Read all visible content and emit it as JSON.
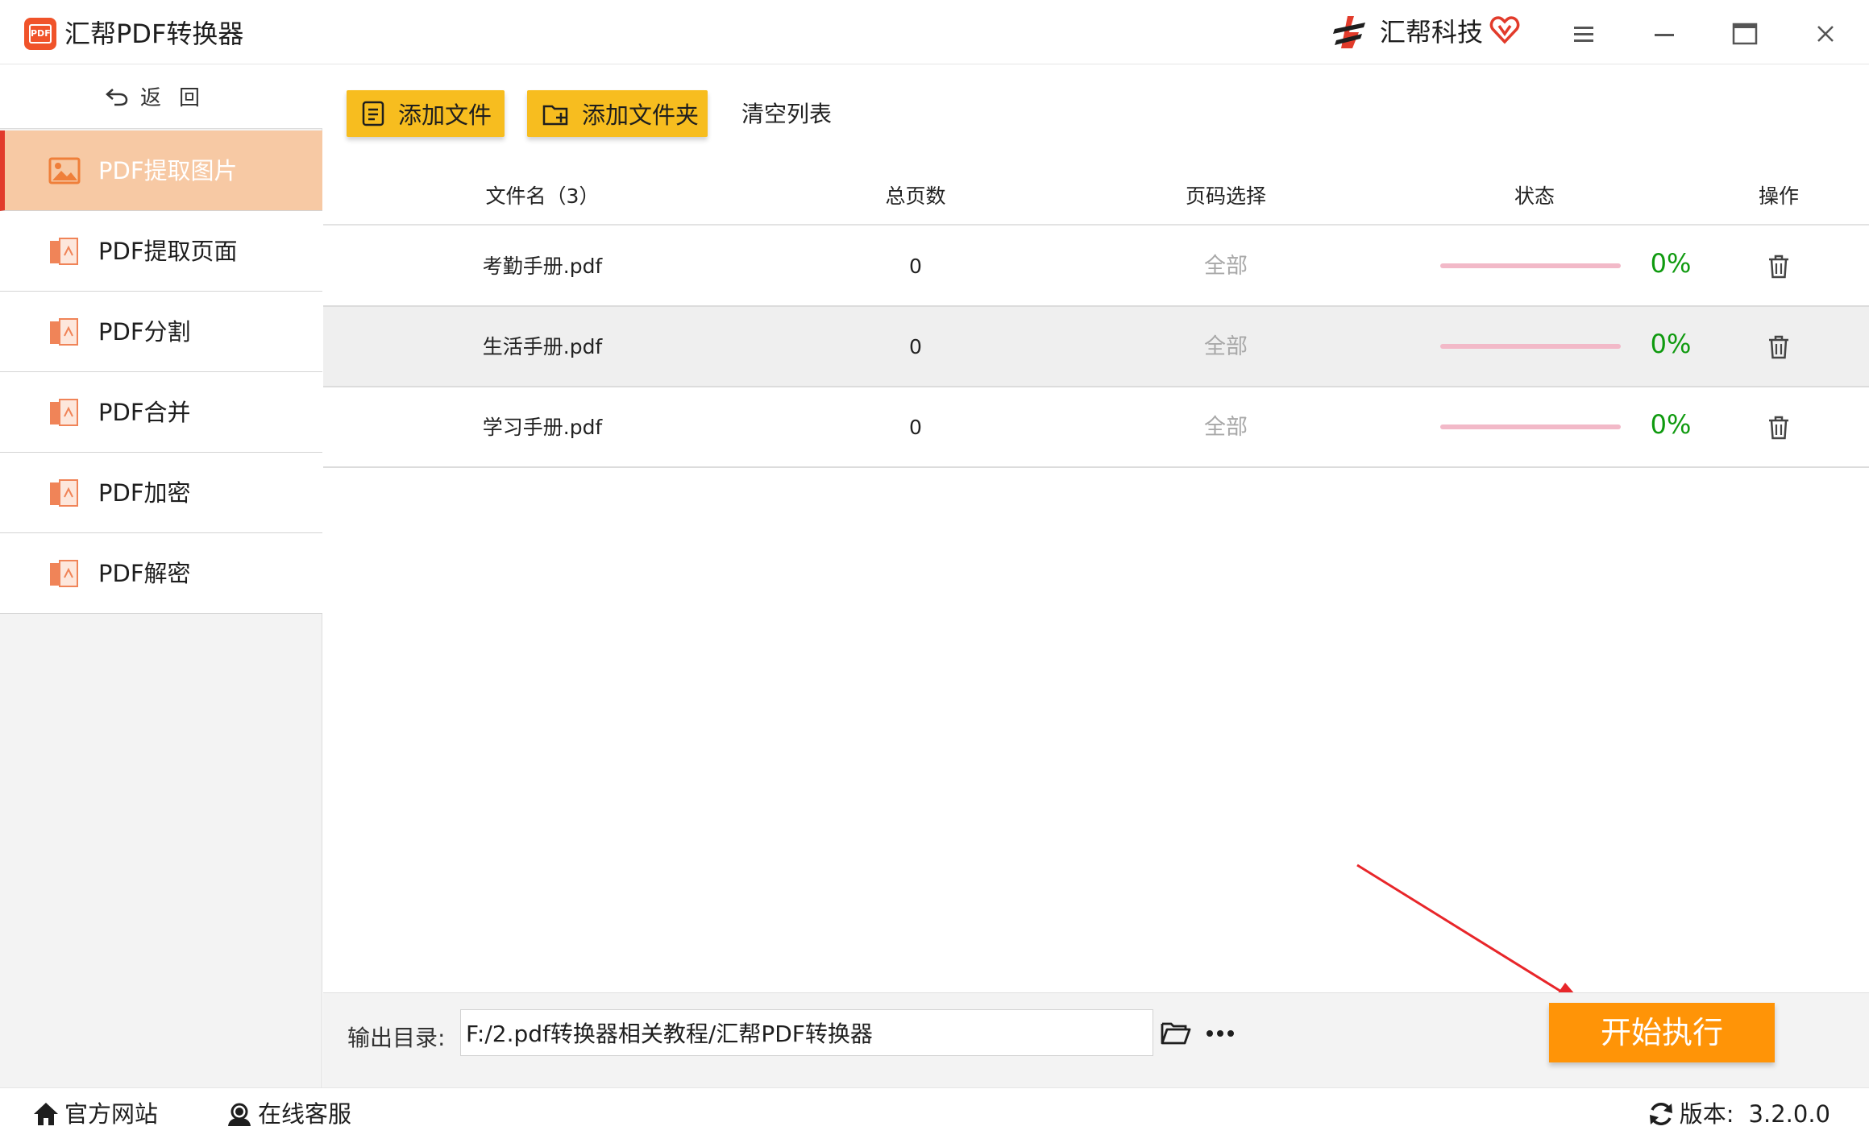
{
  "app": {
    "title": "汇帮PDF转换器",
    "logo_text": "PDF"
  },
  "brand": {
    "name": "汇帮科技",
    "accent": "#e23b2b"
  },
  "sidebar": {
    "back_label": "返回",
    "items": [
      {
        "label": "PDF提取图片",
        "icon": "image-icon",
        "active": true
      },
      {
        "label": "PDF提取页面",
        "icon": "pdf-file-icon",
        "active": false
      },
      {
        "label": "PDF分割",
        "icon": "pdf-file-icon",
        "active": false
      },
      {
        "label": "PDF合并",
        "icon": "pdf-file-icon",
        "active": false
      },
      {
        "label": "PDF加密",
        "icon": "pdf-file-icon",
        "active": false
      },
      {
        "label": "PDF解密",
        "icon": "pdf-file-icon",
        "active": false
      }
    ]
  },
  "toolbar": {
    "add_file_label": "添加文件",
    "add_folder_label": "添加文件夹",
    "clear_list_label": "清空列表",
    "button_color": "#f7bd1f"
  },
  "table": {
    "headers": {
      "filename": "文件名（3）",
      "pages": "总页数",
      "range": "页码选择",
      "status": "状态",
      "action": "操作"
    },
    "rows": [
      {
        "filename": "考勤手册.pdf",
        "pages": "0",
        "range": "全部",
        "progress": 0,
        "percent": "0%"
      },
      {
        "filename": "生活手册.pdf",
        "pages": "0",
        "range": "全部",
        "progress": 0,
        "percent": "0%"
      },
      {
        "filename": "学习手册.pdf",
        "pages": "0",
        "range": "全部",
        "progress": 0,
        "percent": "0%"
      }
    ]
  },
  "output": {
    "label": "输出目录:",
    "path": "F:/2.pdf转换器相关教程/汇帮PDF转换器",
    "start_label": "开始执行",
    "start_color": "#ff9407"
  },
  "footer": {
    "website_label": "官方网站",
    "support_label": "在线客服",
    "version_label": "版本:",
    "version_value": "3.2.0.0"
  }
}
